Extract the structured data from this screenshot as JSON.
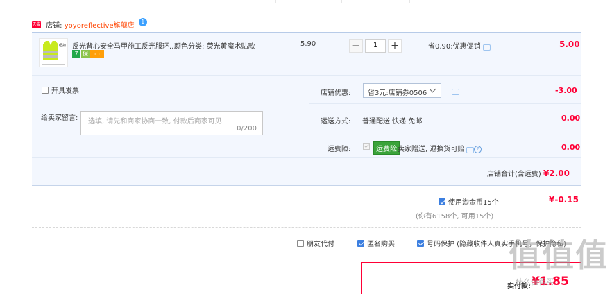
{
  "shop": {
    "badge": "天猫",
    "label": "店铺:",
    "name": "yoyoreflective旗舰店",
    "chat_badge": "1"
  },
  "item": {
    "title": "反光背心安全马甲施工反光服环...",
    "attr_label": "颜色分类:",
    "attr_value": "荧光黄魔术贴款",
    "badges": [
      "7",
      "保",
      "▭"
    ],
    "thumb_brand": "纽扣",
    "price": "5.90",
    "qty": "1",
    "qty_minus": "−",
    "qty_plus": "+",
    "promo": "省0.90:优惠促销",
    "subtotal": "5.00"
  },
  "options": {
    "invoice_label": "开具发票",
    "message_label": "给卖家留言:",
    "message_placeholder": "选填, 请先和商家协商一致, 付款后商家可见",
    "message_count": "0/200",
    "coupon_label": "店铺优惠:",
    "coupon_value": "省3元:店铺券0506",
    "coupon_amount": "-3.00",
    "shipping_label": "运送方式:",
    "shipping_value": "普通配送 快递 免邮",
    "shipping_amount": "0.00",
    "insurance_label": "运费险:",
    "insurance_tag": "运费险",
    "insurance_text": "卖家赠送, 退换货可赔",
    "insurance_amount": "0.00",
    "shop_total_label": "店铺合计(含运费)",
    "shop_total_value": "¥2.00"
  },
  "coins": {
    "label": "使用淘金币15个",
    "value": "¥-0.15",
    "hint": "(你有6158个, 可用15个)"
  },
  "extras": [
    {
      "label": "朋友代付",
      "checked": false
    },
    {
      "label": "匿名购买",
      "checked": true
    },
    {
      "label": "号码保护 (隐藏收件人真实手机号，保护隐私)",
      "checked": true
    }
  ],
  "pay": {
    "label": "实付款:",
    "amount": "¥1.85"
  },
  "watermark": {
    "big": "值值值",
    "small": "什么值得买"
  },
  "colors": {
    "accent": "#ff0036",
    "row_bg": "#f3f7fe",
    "check": "#3c7fe0"
  }
}
